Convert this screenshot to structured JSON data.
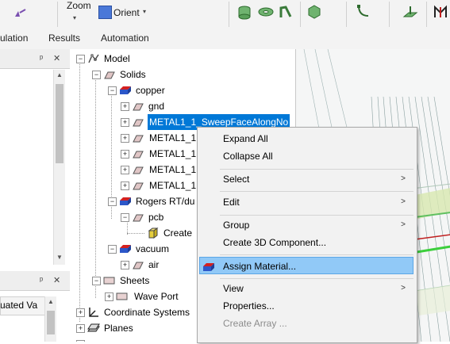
{
  "ribbon": {
    "zoom_label": "Zoom",
    "orient_label": "Orient",
    "tabs": [
      "ulation",
      "Results",
      "Automation"
    ]
  },
  "left_pane": {
    "pin": " ᴠ",
    "close": "✕",
    "column_header": "uated Va"
  },
  "tree": {
    "model": "Model",
    "solids": "Solids",
    "copper": "copper",
    "gnd": "gnd",
    "metal_selected": "METAL1_1_SweepFaceAlongNo",
    "metal_items": [
      "METAL1_1",
      "METAL1_1",
      "METAL1_1",
      "METAL1_1"
    ],
    "rogers": "Rogers RT/du",
    "pcb": "pcb",
    "create": "Create",
    "vacuum": "vacuum",
    "air": "air",
    "sheets": "Sheets",
    "wave_port": "Wave Port",
    "coord_systems": "Coordinate Systems",
    "planes": "Planes"
  },
  "context_menu": {
    "items": [
      {
        "label": "Expand All",
        "submenu": false,
        "disabled": false
      },
      {
        "label": "Collapse All",
        "submenu": false,
        "disabled": false
      },
      {
        "label": "Select",
        "submenu": true,
        "disabled": false
      },
      {
        "label": "Edit",
        "submenu": true,
        "disabled": false
      },
      {
        "label": "Group",
        "submenu": true,
        "disabled": false
      },
      {
        "label": "Create 3D Component...",
        "submenu": false,
        "disabled": false
      },
      {
        "label": "Assign Material...",
        "submenu": false,
        "disabled": false,
        "highlighted": true
      },
      {
        "label": "View",
        "submenu": true,
        "disabled": false
      },
      {
        "label": "Properties...",
        "submenu": false,
        "disabled": false
      },
      {
        "label": "Create Array ...",
        "submenu": false,
        "disabled": true
      }
    ],
    "submenu_arrow": ">"
  },
  "colors": {
    "selection": "#0078d7",
    "menu_hover": "#91c9f7",
    "copper_red": "#d32020",
    "copper_blue": "#2c57c9"
  }
}
